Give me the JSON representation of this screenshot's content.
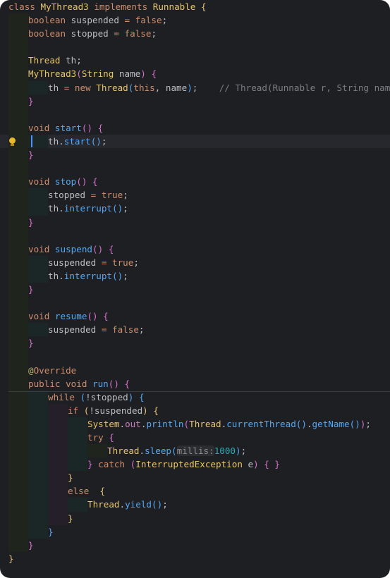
{
  "editor": {
    "language": "Java",
    "theme_colors": {
      "background": "#1e1f22",
      "keyword": "#cf8e6d",
      "class_name": "#e7c56c",
      "method": "#56a8f5",
      "field": "#c77dbb",
      "number": "#2aacb8",
      "comment": "#7a7e85",
      "text": "#bcbec4"
    },
    "caret_line": 11,
    "intention_icon": "lightbulb-icon",
    "lines": [
      {
        "indent": 0,
        "tokens": [
          [
            "kw",
            "class "
          ],
          [
            "cls",
            "MyThread3 "
          ],
          [
            "kw",
            "implements "
          ],
          [
            "cls",
            "Runnable "
          ],
          [
            "p1",
            "{"
          ]
        ]
      },
      {
        "indent": 1,
        "tokens": [
          [
            "kw",
            "boolean "
          ],
          [
            "pl",
            "suspended "
          ],
          [
            "kw",
            "= "
          ],
          [
            "kw",
            "false"
          ],
          [
            "pl",
            ";"
          ]
        ]
      },
      {
        "indent": 1,
        "tokens": [
          [
            "kw",
            "boolean "
          ],
          [
            "pl",
            "stopped "
          ],
          [
            "kw",
            "= "
          ],
          [
            "kw",
            "false"
          ],
          [
            "pl",
            ";"
          ]
        ]
      },
      {
        "indent": 1,
        "tokens": []
      },
      {
        "indent": 1,
        "tokens": [
          [
            "cls",
            "Thread "
          ],
          [
            "pl",
            "th;"
          ]
        ]
      },
      {
        "indent": 1,
        "tokens": [
          [
            "cls",
            "MyThread3"
          ],
          [
            "p2",
            "("
          ],
          [
            "cls",
            "String "
          ],
          [
            "pl",
            "name"
          ],
          [
            "p2",
            ") "
          ],
          [
            "p2",
            "{"
          ]
        ]
      },
      {
        "indent": 2,
        "tokens": [
          [
            "pl",
            "th "
          ],
          [
            "kw",
            "= "
          ],
          [
            "kw",
            "new "
          ],
          [
            "cls",
            "Thread"
          ],
          [
            "p3",
            "("
          ],
          [
            "kw",
            "this"
          ],
          [
            "pl",
            ", name"
          ],
          [
            "p3",
            ")"
          ],
          [
            "pl",
            ";    "
          ],
          [
            "cm",
            "// Thread(Runnable r, String name)"
          ]
        ]
      },
      {
        "indent": 1,
        "tokens": [
          [
            "p2",
            "}"
          ]
        ]
      },
      {
        "indent": 1,
        "tokens": []
      },
      {
        "indent": 1,
        "tokens": [
          [
            "kw",
            "void "
          ],
          [
            "fn",
            "start"
          ],
          [
            "p2",
            "() "
          ],
          [
            "p2",
            "{"
          ]
        ]
      },
      {
        "indent": 2,
        "tokens": [
          [
            "pl",
            "th"
          ],
          [
            "pl",
            "."
          ],
          [
            "fn",
            "start"
          ],
          [
            "p3",
            "()"
          ],
          [
            "pl",
            ";"
          ]
        ]
      },
      {
        "indent": 1,
        "tokens": [
          [
            "p2",
            "}"
          ]
        ]
      },
      {
        "indent": 1,
        "tokens": []
      },
      {
        "indent": 1,
        "tokens": [
          [
            "kw",
            "void "
          ],
          [
            "fn",
            "stop"
          ],
          [
            "p2",
            "() "
          ],
          [
            "p2",
            "{"
          ]
        ]
      },
      {
        "indent": 2,
        "tokens": [
          [
            "pl",
            "stopped "
          ],
          [
            "kw",
            "= "
          ],
          [
            "kw",
            "true"
          ],
          [
            "pl",
            ";"
          ]
        ]
      },
      {
        "indent": 2,
        "tokens": [
          [
            "pl",
            "th"
          ],
          [
            "pl",
            "."
          ],
          [
            "fn",
            "interrupt"
          ],
          [
            "p3",
            "()"
          ],
          [
            "pl",
            ";"
          ]
        ]
      },
      {
        "indent": 1,
        "tokens": [
          [
            "p2",
            "}"
          ]
        ]
      },
      {
        "indent": 1,
        "tokens": []
      },
      {
        "indent": 1,
        "tokens": [
          [
            "kw",
            "void "
          ],
          [
            "fn",
            "suspend"
          ],
          [
            "p2",
            "() "
          ],
          [
            "p2",
            "{"
          ]
        ]
      },
      {
        "indent": 2,
        "tokens": [
          [
            "pl",
            "suspended "
          ],
          [
            "kw",
            "= "
          ],
          [
            "kw",
            "true"
          ],
          [
            "pl",
            ";"
          ]
        ]
      },
      {
        "indent": 2,
        "tokens": [
          [
            "pl",
            "th"
          ],
          [
            "pl",
            "."
          ],
          [
            "fn",
            "interrupt"
          ],
          [
            "p3",
            "()"
          ],
          [
            "pl",
            ";"
          ]
        ]
      },
      {
        "indent": 1,
        "tokens": [
          [
            "p2",
            "}"
          ]
        ]
      },
      {
        "indent": 1,
        "tokens": []
      },
      {
        "indent": 1,
        "tokens": [
          [
            "kw",
            "void "
          ],
          [
            "fn",
            "resume"
          ],
          [
            "p2",
            "() "
          ],
          [
            "p2",
            "{"
          ]
        ]
      },
      {
        "indent": 2,
        "tokens": [
          [
            "pl",
            "suspended "
          ],
          [
            "kw",
            "= "
          ],
          [
            "kw",
            "false"
          ],
          [
            "pl",
            ";"
          ]
        ]
      },
      {
        "indent": 1,
        "tokens": [
          [
            "p2",
            "}"
          ]
        ]
      },
      {
        "indent": 1,
        "tokens": []
      },
      {
        "indent": 1,
        "tokens": [
          [
            "an",
            "@"
          ],
          [
            "kw",
            "Override"
          ]
        ]
      },
      {
        "indent": 1,
        "tokens": [
          [
            "kw",
            "public "
          ],
          [
            "kw",
            "void "
          ],
          [
            "fn",
            "run"
          ],
          [
            "p2",
            "() "
          ],
          [
            "p2",
            "{"
          ]
        ]
      },
      {
        "indent": 2,
        "tokens": [
          [
            "kw",
            "while "
          ],
          [
            "p3",
            "("
          ],
          [
            "pl",
            "!stopped"
          ],
          [
            "p3",
            ") "
          ],
          [
            "p3",
            "{"
          ]
        ]
      },
      {
        "indent": 3,
        "tokens": [
          [
            "kw",
            "if "
          ],
          [
            "p1",
            "("
          ],
          [
            "pl",
            "!suspended"
          ],
          [
            "p1",
            ") "
          ],
          [
            "p1",
            "{"
          ]
        ]
      },
      {
        "indent": 4,
        "tokens": [
          [
            "cls",
            "System"
          ],
          [
            "pl",
            "."
          ],
          [
            "fd",
            "out"
          ],
          [
            "pl",
            "."
          ],
          [
            "fn",
            "println"
          ],
          [
            "p2",
            "("
          ],
          [
            "cls",
            "Thread"
          ],
          [
            "pl",
            "."
          ],
          [
            "fn",
            "currentThread"
          ],
          [
            "p3",
            "()"
          ],
          [
            "pl",
            "."
          ],
          [
            "fn",
            "getName"
          ],
          [
            "p3",
            "()"
          ],
          [
            "p2",
            ")"
          ],
          [
            "pl",
            ";"
          ]
        ]
      },
      {
        "indent": 4,
        "tokens": [
          [
            "kw",
            "try "
          ],
          [
            "p2",
            "{"
          ]
        ]
      },
      {
        "indent": 5,
        "tokens": [
          [
            "cls",
            "Thread"
          ],
          [
            "pl",
            "."
          ],
          [
            "fn",
            "sleep"
          ],
          [
            "p3",
            "("
          ],
          [
            "hint",
            "millis:"
          ],
          [
            "num",
            "1000"
          ],
          [
            "p3",
            ")"
          ],
          [
            "pl",
            ";"
          ]
        ]
      },
      {
        "indent": 4,
        "tokens": [
          [
            "p2",
            "} "
          ],
          [
            "kw",
            "catch "
          ],
          [
            "p2",
            "("
          ],
          [
            "cls",
            "InterruptedException "
          ],
          [
            "pl",
            "e"
          ],
          [
            "p2",
            ") "
          ],
          [
            "p2",
            "{ }"
          ]
        ]
      },
      {
        "indent": 3,
        "tokens": [
          [
            "p1",
            "}"
          ]
        ]
      },
      {
        "indent": 3,
        "tokens": [
          [
            "kw",
            "else  "
          ],
          [
            "p1",
            "{"
          ]
        ]
      },
      {
        "indent": 4,
        "tokens": [
          [
            "cls",
            "Thread"
          ],
          [
            "pl",
            "."
          ],
          [
            "fn",
            "yield"
          ],
          [
            "p3",
            "()"
          ],
          [
            "pl",
            ";"
          ]
        ]
      },
      {
        "indent": 3,
        "tokens": [
          [
            "p1",
            "}"
          ]
        ]
      },
      {
        "indent": 2,
        "tokens": [
          [
            "p3",
            "}"
          ]
        ]
      },
      {
        "indent": 1,
        "tokens": [
          [
            "p2",
            "}"
          ]
        ]
      },
      {
        "indent": 0,
        "tokens": [
          [
            "p1",
            "}"
          ]
        ]
      }
    ]
  }
}
